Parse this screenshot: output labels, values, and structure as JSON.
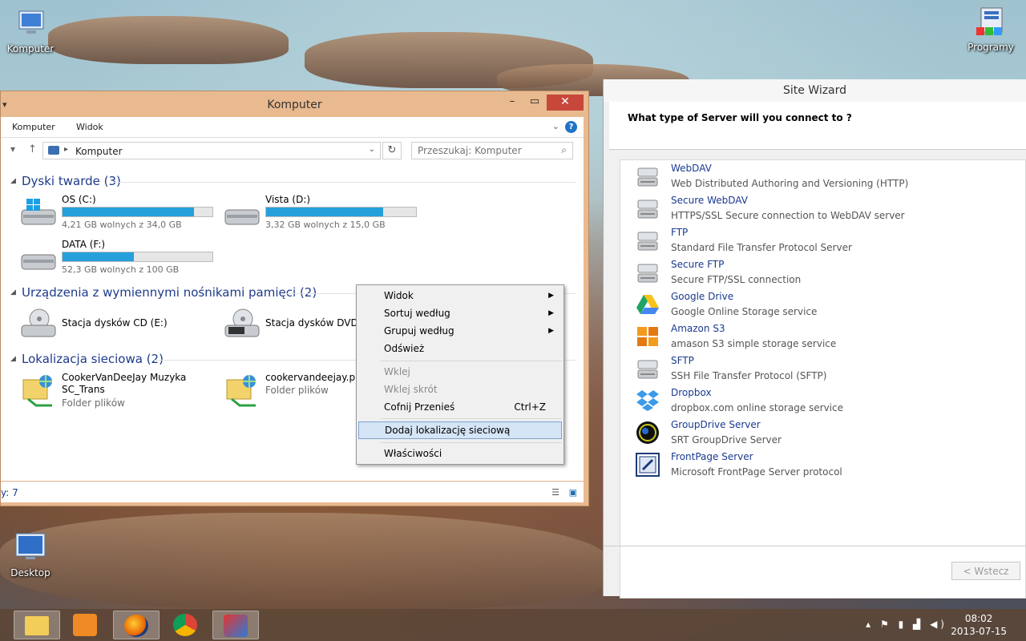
{
  "desktop": {
    "icons": [
      {
        "label": "Komputer"
      },
      {
        "label": "Programy"
      },
      {
        "label": "Desktop"
      }
    ]
  },
  "explorer": {
    "title": "Komputer",
    "close_label": "✕",
    "ribbon": {
      "tab_komputer": "Komputer",
      "tab_widok": "Widok"
    },
    "address": {
      "path": "Komputer"
    },
    "search": {
      "placeholder": "Przeszukaj: Komputer"
    },
    "groups": {
      "hard_drives": "Dyski twarde (3)",
      "removable": "Urządzenia z wymiennymi nośnikami pamięci (2)",
      "network": "Lokalizacja sieciowa (2)"
    },
    "drives": [
      {
        "name": "OS (C:)",
        "free_text": "4,21 GB wolnych z 34,0 GB",
        "used_fraction": 0.876
      },
      {
        "name": "Vista (D:)",
        "free_text": "3,32 GB wolnych z 15,0 GB",
        "used_fraction": 0.779
      },
      {
        "name": "DATA (F:)",
        "free_text": "52,3 GB wolnych z 100 GB",
        "used_fraction": 0.477
      }
    ],
    "removable_devices": [
      {
        "name": "Stacja dysków CD (E:)"
      },
      {
        "name": "Stacja dysków DVD RW"
      }
    ],
    "network_locations": [
      {
        "name": "CookerVanDeeJay Muzyka SC_Trans",
        "type": "Folder plików"
      },
      {
        "name": "cookervandeejay.pl",
        "type": "Folder plików"
      }
    ],
    "status": {
      "count": "y: 7"
    }
  },
  "context_menu": {
    "items": [
      {
        "label": "Widok"
      },
      {
        "label": "Sortuj według"
      },
      {
        "label": "Grupuj według"
      },
      {
        "label": "Odśwież"
      },
      {
        "label": "Wklej"
      },
      {
        "label": "Wklej skrót"
      },
      {
        "label": "Cofnij Przenieś",
        "shortcut": "Ctrl+Z"
      },
      {
        "label": "Dodaj lokalizację sieciową"
      },
      {
        "label": "Właściwości"
      }
    ]
  },
  "wizard": {
    "title": "Site Wizard",
    "question": "What type of Server will you connect to ?",
    "servers": [
      {
        "name": "WebDAV",
        "desc": "Web Distributed Authoring and Versioning (HTTP)"
      },
      {
        "name": "Secure WebDAV",
        "desc": "HTTPS/SSL Secure connection to WebDAV server"
      },
      {
        "name": "FTP",
        "desc": "Standard File Transfer Protocol Server"
      },
      {
        "name": "Secure FTP",
        "desc": "Secure FTP/SSL connection"
      },
      {
        "name": "Google Drive",
        "desc": "Google Online Storage service"
      },
      {
        "name": "Amazon S3",
        "desc": "amason S3 simple storage service"
      },
      {
        "name": "SFTP",
        "desc": "SSH File Transfer Protocol (SFTP)"
      },
      {
        "name": "Dropbox",
        "desc": "dropbox.com online storage service"
      },
      {
        "name": "GroupDrive Server",
        "desc": "SRT GroupDrive Server"
      },
      {
        "name": "FrontPage Server",
        "desc": "Microsoft FrontPage Server protocol"
      }
    ],
    "back_button": "< Wstecz"
  },
  "taskbar": {
    "clock_time": "08:02",
    "clock_date": "2013-07-15"
  },
  "colors": {
    "accent_blue": "#26a0da",
    "explorer_frame": "#e9b98f",
    "close_red": "#c7473b",
    "link_blue": "#1a3a8f"
  }
}
